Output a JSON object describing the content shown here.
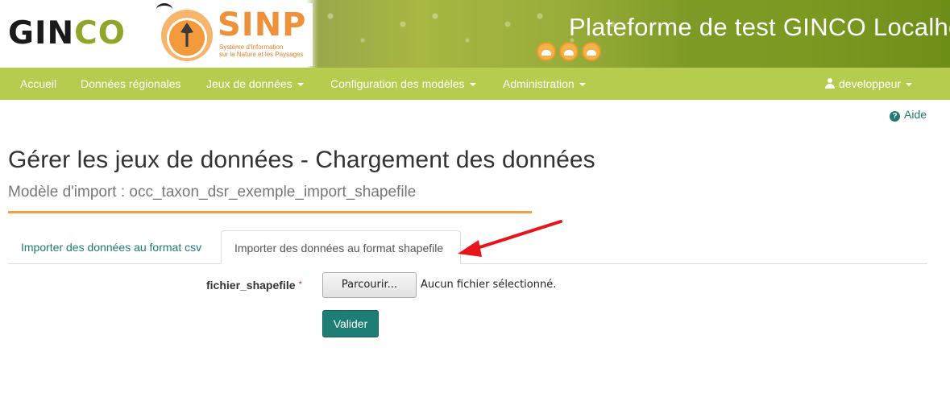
{
  "header": {
    "logo_text_main": "GIN",
    "logo_text_accent": "CO",
    "partner_logo_text": "SINP",
    "partner_logo_subtitle_1": "Système d'Information",
    "partner_logo_subtitle_2": "sur la Nature et les Paysages",
    "site_title": "Plateforme de test GINCO Localhost"
  },
  "navbar": {
    "items": [
      {
        "label": "Accueil",
        "has_caret": false
      },
      {
        "label": "Données régionales",
        "has_caret": false
      },
      {
        "label": "Jeux de données",
        "has_caret": true
      },
      {
        "label": "Configuration des modèles",
        "has_caret": true
      },
      {
        "label": "Administration",
        "has_caret": true
      }
    ],
    "user": {
      "label": "developpeur",
      "icon": "user-icon"
    }
  },
  "help": {
    "label": "Aide",
    "icon": "question-circle-icon"
  },
  "page": {
    "title": "Gérer les jeux de données - Chargement des données",
    "subtitle": "Modèle d'import : occ_taxon_dsr_exemple_import_shapefile"
  },
  "tabs": [
    {
      "label": "Importer des données au format csv",
      "active": false
    },
    {
      "label": "Importer des données au format shapefile",
      "active": true
    }
  ],
  "form": {
    "field_label": "fichier_shapefile",
    "required_marker": "*",
    "browse_label": "Parcourir...",
    "file_status": "Aucun fichier sélectionné.",
    "submit_label": "Valider"
  },
  "colors": {
    "navbar": "#b5cc4f",
    "accent_teal": "#1d7e76",
    "title_rule": "#f0a13c",
    "annotation_arrow": "#e8141b"
  }
}
